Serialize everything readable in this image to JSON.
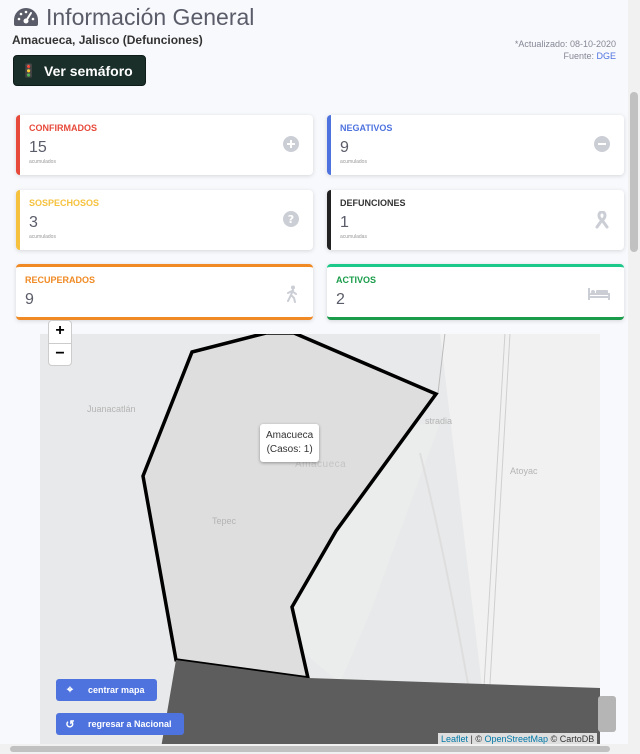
{
  "header": {
    "title": "Información General",
    "subtitle": "Amacueca, Jalisco (Defunciones)",
    "updated": "*Actualizado: 08-10-2020",
    "source_prefix": "Fuente: ",
    "source_link": "DGE",
    "semaforo_button": "Ver semáforo"
  },
  "cards": {
    "confirmados": {
      "label": "CONFIRMADOS",
      "value": "15",
      "note": "acumulados",
      "color": "#e74a3b",
      "icon": "plus-circle-icon"
    },
    "negativos": {
      "label": "NEGATIVOS",
      "value": "9",
      "note": "acumulados",
      "color": "#4e73df",
      "icon": "minus-circle-icon"
    },
    "sospechosos": {
      "label": "SOSPECHOSOS",
      "value": "3",
      "note": "acumulados",
      "color": "#f6c23e",
      "icon": "question-circle-icon"
    },
    "defunciones": {
      "label": "DEFUNCIONES",
      "value": "1",
      "note": "acumuladas",
      "color": "#333333",
      "icon": "ribbon-icon"
    },
    "recuperados": {
      "label": "RECUPERADOS",
      "value": "9",
      "color": "#f08a24",
      "icon": "walking-icon"
    },
    "activos": {
      "label": "ACTIVOS",
      "value": "2",
      "color": "#1cc88a",
      "icon": "bed-icon"
    }
  },
  "map": {
    "zoom_in": "+",
    "zoom_out": "−",
    "places": {
      "juanacatlan": "Juanacatlán",
      "amacueca": "Amacueca",
      "tepec": "Tepec",
      "atoyac": "Atoyac",
      "estradia": "stradia"
    },
    "tooltip": {
      "name": "Amacueca",
      "cases": "(Casos: 1)"
    },
    "buttons": {
      "center": "centrar mapa",
      "back": "regresar a Nacional"
    },
    "attribution": {
      "leaflet": "Leaflet",
      "sep1": " | © ",
      "osm": "OpenStreetMap",
      "sep2": " © ",
      "carto": "CartoDB"
    }
  }
}
